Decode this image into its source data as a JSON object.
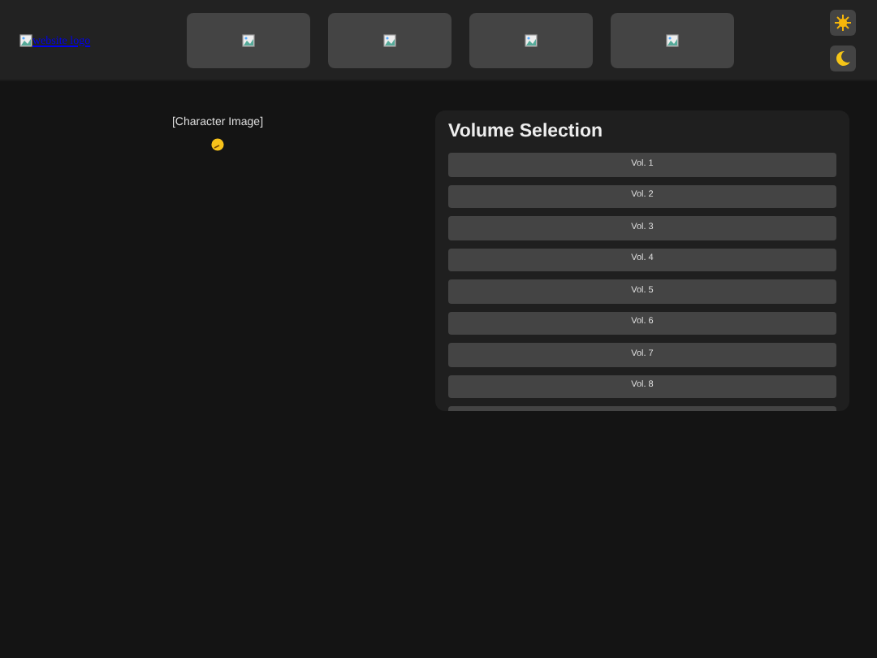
{
  "header": {
    "logo_alt": "website logo",
    "nav_tiles": [
      {
        "kind": "broken-image"
      },
      {
        "kind": "broken-image"
      },
      {
        "kind": "broken-image"
      },
      {
        "kind": "broken-image"
      }
    ],
    "theme_buttons": [
      {
        "kind": "sun"
      },
      {
        "kind": "moon"
      }
    ]
  },
  "character": {
    "image_label": "[Character Image]"
  },
  "volume_panel": {
    "title": "Volume Selection",
    "volumes": [
      "Vol. 1",
      "Vol. 2",
      "Vol. 3",
      "Vol. 4",
      "Vol. 5",
      "Vol. 6",
      "Vol. 7",
      "Vol. 8"
    ]
  }
}
